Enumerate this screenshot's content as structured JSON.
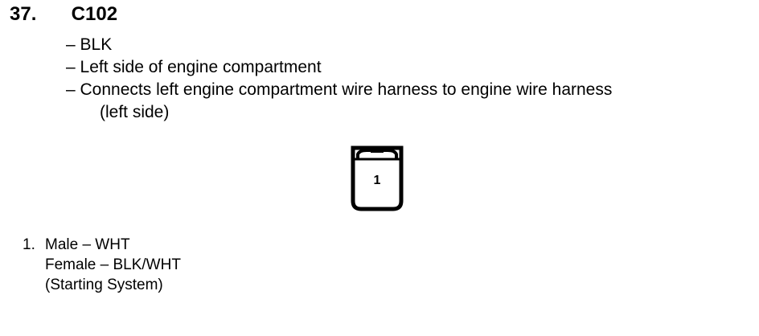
{
  "heading": {
    "number": "37.",
    "code": "C102"
  },
  "bullets": [
    "– BLK",
    "– Left side of engine compartment",
    "– Connects left engine compartment wire harness to engine wire harness"
  ],
  "bullet_continuation": "(left side)",
  "connector": {
    "pin_label": "1"
  },
  "pins": [
    {
      "number": "1.",
      "male": "Male – WHT",
      "female": "Female – BLK/WHT",
      "system": "(Starting System)"
    }
  ]
}
